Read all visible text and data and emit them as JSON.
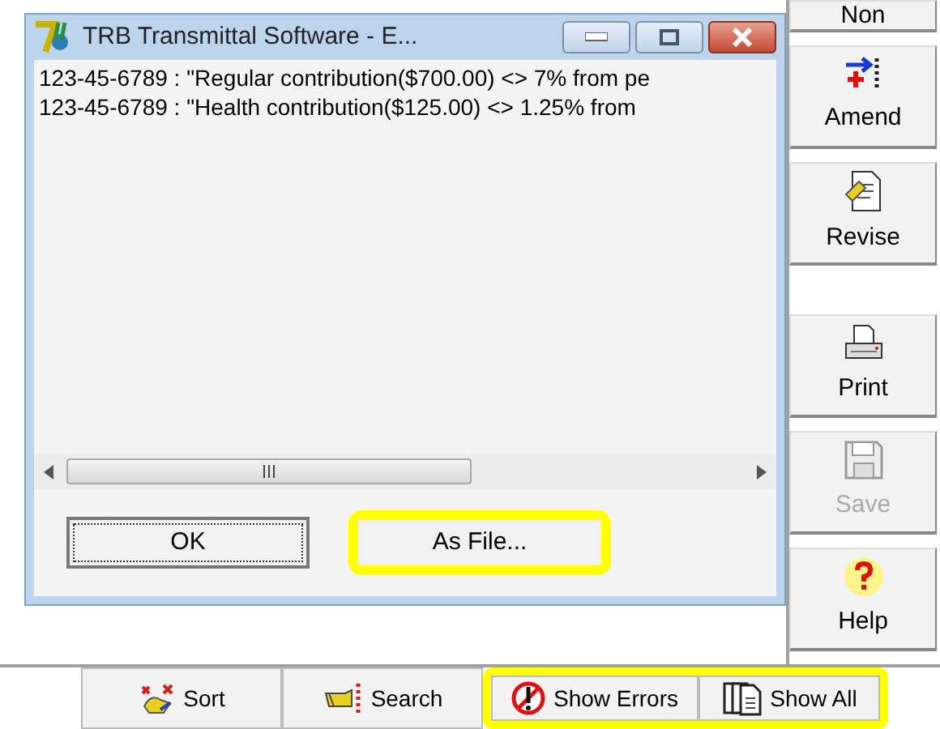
{
  "dialog": {
    "title": "TRB Transmittal Software - E...",
    "lines": [
      "123-45-6789 : \"Regular contribution($700.00) <> 7% from pe",
      "123-45-6789 : \"Health contribution($125.00) <> 1.25% from"
    ],
    "buttons": [
      {
        "label": "OK",
        "kind": "default",
        "highlighted": false
      },
      {
        "label": "As File...",
        "kind": "plain",
        "highlighted": true
      }
    ]
  },
  "sidebar": [
    {
      "label": "Non",
      "kind": "stub",
      "disabled": false
    },
    {
      "label": "Amend",
      "kind": "amend",
      "disabled": false
    },
    {
      "label": "Revise",
      "kind": "revise",
      "disabled": false
    },
    {
      "label": "Print",
      "kind": "print",
      "disabled": false
    },
    {
      "label": "Save",
      "kind": "save",
      "disabled": true
    },
    {
      "label": "Help",
      "kind": "help",
      "disabled": false
    }
  ],
  "toolbar": [
    {
      "label": "Sort",
      "kind": "sort",
      "highlighted": false
    },
    {
      "label": "Search",
      "kind": "search",
      "highlighted": false
    },
    {
      "label": "Show Errors",
      "kind": "errors",
      "highlighted": true
    },
    {
      "label": "Show All",
      "kind": "pages",
      "highlighted": true
    }
  ]
}
